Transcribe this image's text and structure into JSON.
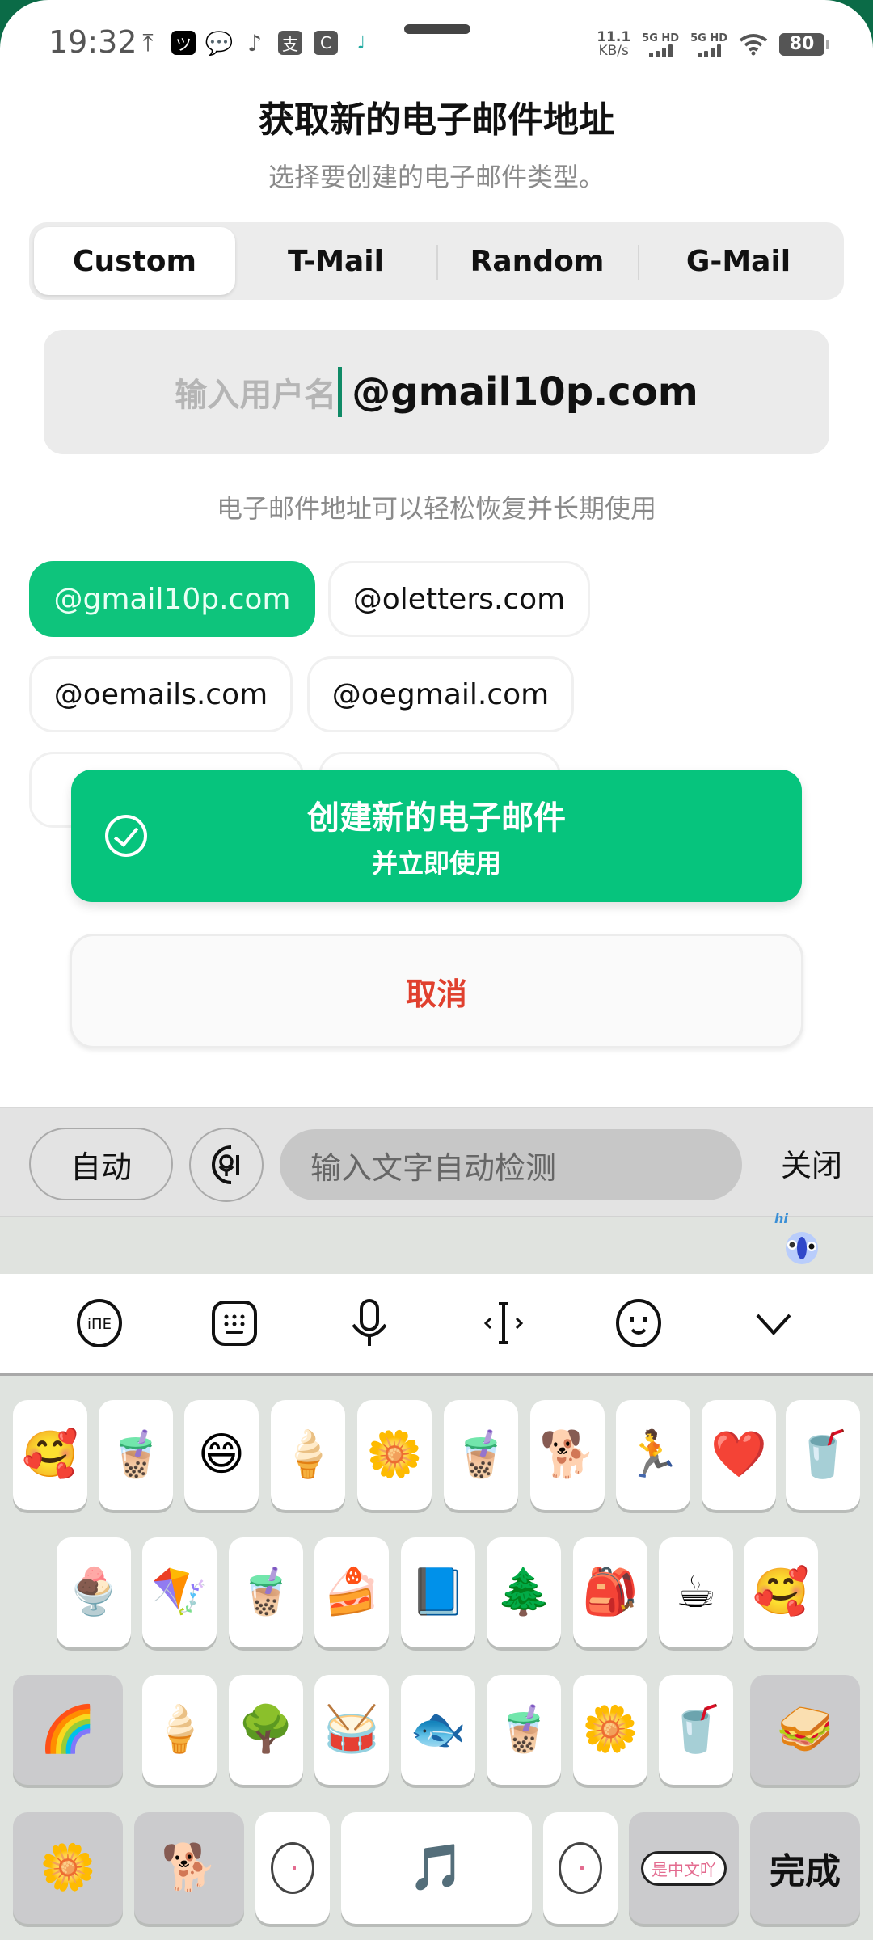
{
  "status_bar": {
    "time": "19:32",
    "notification_icons": [
      "upload-icon",
      "camera-app-icon",
      "wechat-icon",
      "tiktok-icon",
      "alipay-icon",
      "bank-app-icon",
      "music-note-icon"
    ],
    "net_speed_value": "11.1",
    "net_speed_unit": "KB/s",
    "sim1_label": "5G HD",
    "sim2_label": "5G HD",
    "battery": "80"
  },
  "header": {
    "title": "获取新的电子邮件地址",
    "subtitle": "选择要创建的电子邮件类型。"
  },
  "tabs": [
    {
      "label": "Custom",
      "active": true
    },
    {
      "label": "T-Mail",
      "active": false
    },
    {
      "label": "Random",
      "active": false
    },
    {
      "label": "G-Mail",
      "active": false
    }
  ],
  "username_input": {
    "placeholder": "输入用户名",
    "value": "",
    "domain_suffix": "@gmail10p.com"
  },
  "hint": "电子邮件地址可以轻松恢复并长期使用",
  "domain_chips": [
    {
      "label": "@gmail10p.com",
      "selected": true
    },
    {
      "label": "@oletters.com",
      "selected": false
    },
    {
      "label": "@oemails.com",
      "selected": false
    },
    {
      "label": "@oegmail.com",
      "selected": false
    }
  ],
  "create_button": {
    "line1": "创建新的电子邮件",
    "line2": "并立即使用"
  },
  "cancel_button": "取消",
  "ime": {
    "auto_label": "自动",
    "input_placeholder": "输入文字自动检测",
    "close_label": "关闭",
    "mascot_text": "hi",
    "toolbar": [
      "translate-icon",
      "keyboard-icon",
      "microphone-icon",
      "cursor-icon",
      "emoji-icon",
      "collapse-chevron-icon"
    ]
  },
  "sticker_keyboard": {
    "row1": [
      "🥰",
      "🧋",
      "😄",
      "🍦",
      "🌼",
      "🧋",
      "🐕",
      "🏃",
      "❤️",
      "🥤"
    ],
    "row2": [
      "🍨",
      "🪁",
      "🧋",
      "🍰",
      "📘",
      "🌲",
      "🎒",
      "☕",
      "🥰"
    ],
    "row3": [
      "🌈",
      "🍦",
      "🌳",
      "🥁",
      "🐟",
      "🧋",
      "🌼",
      "🥤",
      "🥪"
    ],
    "row4": {
      "stickers": [
        "🌼",
        "🐕",
        "",
        "🎵",
        ""
      ],
      "bubble_text": "是中文吖",
      "done_label": "完成"
    },
    "colors": {
      "accent": "#06c47d",
      "cancel": "#e0402e"
    }
  }
}
